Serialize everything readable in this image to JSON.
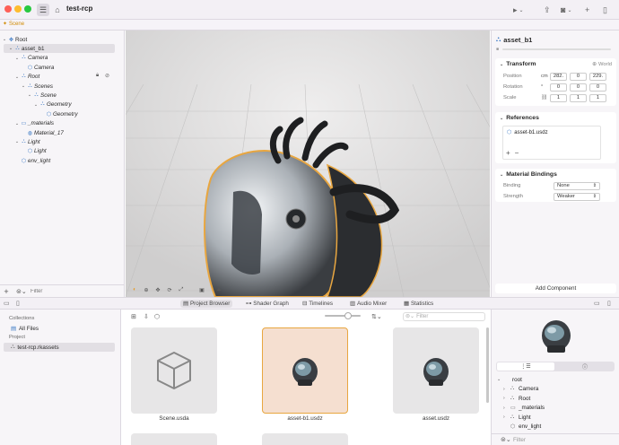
{
  "window": {
    "title": "test-rcp",
    "scene_tab": "Scene"
  },
  "hierarchy": {
    "rows": [
      {
        "label": "Root",
        "depth": 0,
        "disc": "⌄",
        "icon": "✥",
        "italic": false
      },
      {
        "label": "asset_b1",
        "depth": 1,
        "disc": "⌄",
        "icon": "⛬",
        "italic": false,
        "selected": true
      },
      {
        "label": "Camera",
        "depth": 2,
        "disc": "⌄",
        "icon": "⛬",
        "italic": true
      },
      {
        "label": "Camera",
        "depth": 3,
        "disc": "",
        "icon": "⬡",
        "italic": true
      },
      {
        "label": "Root",
        "depth": 2,
        "disc": "⌄",
        "icon": "⛬",
        "italic": true
      },
      {
        "label": "Scenes",
        "depth": 3,
        "disc": "⌄",
        "icon": "⛬",
        "italic": true
      },
      {
        "label": "Scene",
        "depth": 4,
        "disc": "⌄",
        "icon": "⛬",
        "italic": true
      },
      {
        "label": "Geometry",
        "depth": 5,
        "disc": "⌄",
        "icon": "⛬",
        "italic": true
      },
      {
        "label": "Geometry",
        "depth": 6,
        "disc": "",
        "icon": "⬡",
        "italic": true
      },
      {
        "label": "_materials",
        "depth": 2,
        "disc": "⌄",
        "icon": "▭",
        "italic": true
      },
      {
        "label": "Material_17",
        "depth": 3,
        "disc": "",
        "icon": "◍",
        "italic": true
      },
      {
        "label": "Light",
        "depth": 2,
        "disc": "⌄",
        "icon": "⛬",
        "italic": true
      },
      {
        "label": "Light",
        "depth": 3,
        "disc": "",
        "icon": "⬡",
        "italic": true
      },
      {
        "label": "env_light",
        "depth": 2,
        "disc": "",
        "icon": "⬡",
        "italic": true
      }
    ],
    "filter_placeholder": "Filter"
  },
  "inspector": {
    "entity_name": "asset_b1",
    "transform": {
      "title": "Transform",
      "space": "World",
      "position_label": "Position",
      "position_unit": "cm",
      "position": [
        "282.",
        "0",
        "229."
      ],
      "rotation_label": "Rotation",
      "rotation_unit": "°",
      "rotation": [
        "0",
        "0",
        "0"
      ],
      "scale_label": "Scale",
      "scale": [
        "1",
        "1",
        "1"
      ]
    },
    "references": {
      "title": "References",
      "item": "asset-b1.usdz"
    },
    "material_bindings": {
      "title": "Material Bindings",
      "binding_label": "Binding",
      "binding_value": "None",
      "strength_label": "Strength",
      "strength_value": "Weaker"
    },
    "add_component": "Add Component"
  },
  "bottom_tabs": [
    "Project Browser",
    "Shader Graph",
    "Timelines",
    "Audio Mixer",
    "Statistics"
  ],
  "project_sidebar": {
    "collections_header": "Collections",
    "all_files": "All Files",
    "project_header": "Project",
    "project_item": "test-rcp.rkassets"
  },
  "browser": {
    "filter_placeholder": "Filter",
    "items": [
      {
        "label": "Scene.usda"
      },
      {
        "label": "asset-b1.usdz"
      },
      {
        "label": "asset.usdz"
      }
    ]
  },
  "preview": {
    "tree": [
      {
        "label": "root",
        "depth": 0,
        "disc": "⌄",
        "icon": ""
      },
      {
        "label": "Camera",
        "depth": 1,
        "disc": "›",
        "icon": "⛬"
      },
      {
        "label": "Root",
        "depth": 1,
        "disc": "›",
        "icon": "⛬"
      },
      {
        "label": "_materials",
        "depth": 1,
        "disc": "›",
        "icon": "▭"
      },
      {
        "label": "Light",
        "depth": 1,
        "disc": "›",
        "icon": "⛬"
      },
      {
        "label": "env_light",
        "depth": 1,
        "disc": "",
        "icon": "⬡"
      }
    ],
    "filter_placeholder": "Filter"
  },
  "colors": {
    "accent": "#e8a640",
    "selection": "#e2dfe4",
    "icon_blue": "#3a78c4"
  }
}
